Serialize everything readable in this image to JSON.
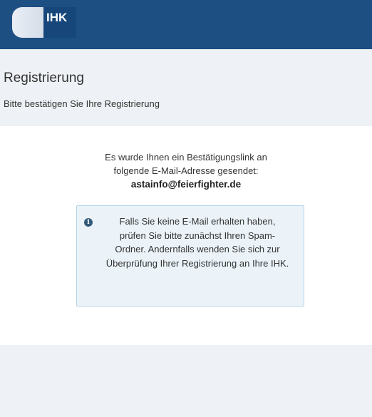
{
  "header": {
    "logo_text": "IHK",
    "brand_color": "#1d4f82"
  },
  "page": {
    "title": "Registrierung",
    "subtitle": "Bitte bestätigen Sie Ihre Registrierung"
  },
  "message": {
    "line1": "Es wurde Ihnen ein Bestätigungslink an",
    "line2": "folgende E-Mail-Adresse gesendet:",
    "email": "astainfo@feierfighter.de"
  },
  "info": {
    "icon": "info-circle-icon",
    "text": "Falls Sie keine E-Mail erhalten haben, prüfen Sie bitte zunächst Ihren Spam-Ordner. Andernfalls wenden Sie sich zur Überprüfung Ihrer Registrierung an Ihre IHK.",
    "background": "#ebf3f9",
    "border": "#b5d5ea"
  }
}
